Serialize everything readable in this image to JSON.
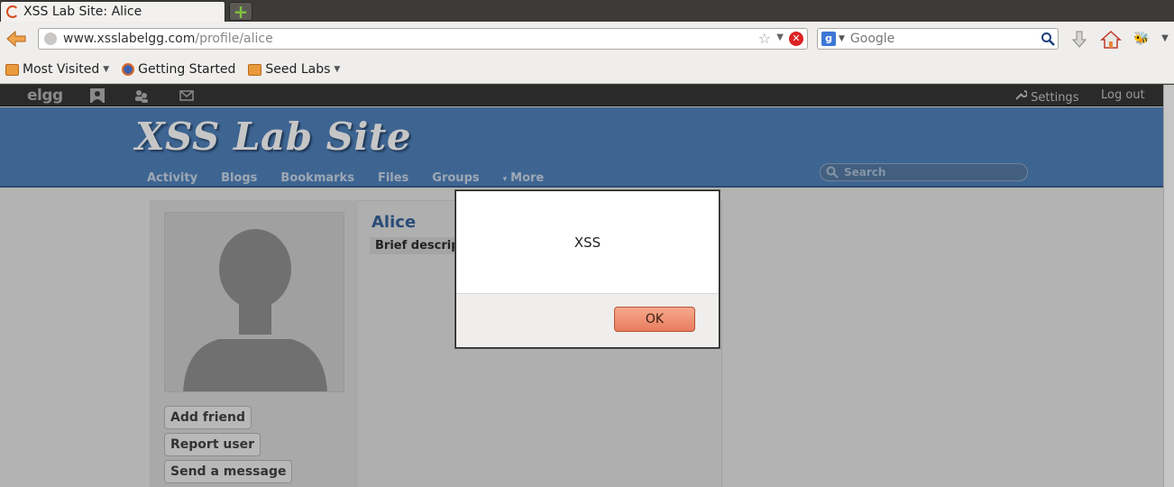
{
  "browser": {
    "tab_title": "XSS Lab Site: Alice",
    "url_host": "www.xsslabelgg.com",
    "url_path": "/profile/alice",
    "search_engine_placeholder": "Google",
    "bookmarks": [
      "Most Visited",
      "Getting Started",
      "Seed Labs"
    ]
  },
  "topbar": {
    "logo": "elgg",
    "settings_label": "Settings",
    "logout_label": "Log out"
  },
  "site": {
    "title": "XSS Lab Site",
    "menu": [
      "Activity",
      "Blogs",
      "Bookmarks",
      "Files",
      "Groups",
      "More"
    ],
    "more_caret": "▾",
    "search_placeholder": "Search"
  },
  "profile": {
    "name": "Alice",
    "brief_description_label": "Brief description:",
    "buttons": [
      "Add friend",
      "Report user",
      "Send a message"
    ]
  },
  "alert": {
    "message": "XSS",
    "ok_label": "OK"
  },
  "colors": {
    "header": "#3e6592",
    "accent_orange": "#e87c5e",
    "name_link": "#2a4c78"
  }
}
